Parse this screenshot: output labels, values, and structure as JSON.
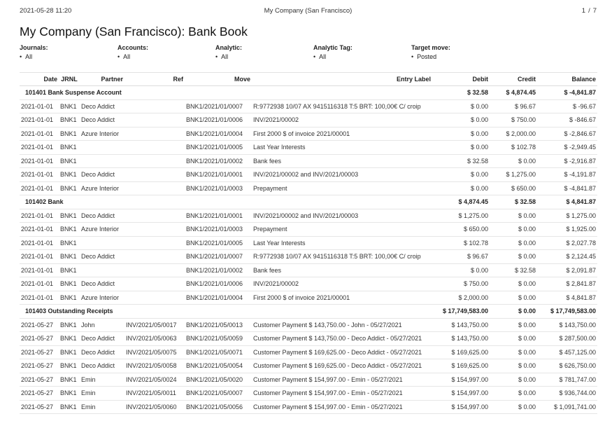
{
  "print_header": {
    "timestamp": "2021-05-28 11:20",
    "company": "My Company (San Francisco)",
    "page_current": "1",
    "page_sep": "/",
    "page_total": "7"
  },
  "title": "My Company (San Francisco): Bank Book",
  "filters": [
    {
      "label": "Journals:",
      "value": "All"
    },
    {
      "label": "Accounts:",
      "value": "All"
    },
    {
      "label": "Analytic:",
      "value": "All"
    },
    {
      "label": "Analytic Tag:",
      "value": "All"
    },
    {
      "label": "Target move:",
      "value": "Posted"
    }
  ],
  "columns": {
    "date": "Date",
    "jrnl": "JRNL",
    "partner": "Partner",
    "ref": "Ref",
    "move": "Move",
    "entry_label": "Entry Label",
    "debit": "Debit",
    "credit": "Credit",
    "balance": "Balance"
  },
  "accounts": [
    {
      "name": "101401 Bank Suspense Account",
      "debit": "$ 32.58",
      "credit": "$ 4,874.45",
      "balance": "$ -4,841.87",
      "lines": [
        {
          "date": "2021-01-01",
          "jrnl": "BNK1",
          "partner": "Deco Addict",
          "ref": "",
          "move": "BNK1/2021/01/0007",
          "label": "R:9772938 10/07 AX 9415116318 T:5 BRT: 100,00€ C/ croip",
          "debit": "$ 0.00",
          "credit": "$ 96.67",
          "balance": "$ -96.67"
        },
        {
          "date": "2021-01-01",
          "jrnl": "BNK1",
          "partner": "Deco Addict",
          "ref": "",
          "move": "BNK1/2021/01/0006",
          "label": "INV/2021/00002",
          "debit": "$ 0.00",
          "credit": "$ 750.00",
          "balance": "$ -846.67"
        },
        {
          "date": "2021-01-01",
          "jrnl": "BNK1",
          "partner": "Azure Interior",
          "ref": "",
          "move": "BNK1/2021/01/0004",
          "label": "First 2000 $ of invoice 2021/00001",
          "debit": "$ 0.00",
          "credit": "$ 2,000.00",
          "balance": "$ -2,846.67"
        },
        {
          "date": "2021-01-01",
          "jrnl": "BNK1",
          "partner": "",
          "ref": "",
          "move": "BNK1/2021/01/0005",
          "label": "Last Year Interests",
          "debit": "$ 0.00",
          "credit": "$ 102.78",
          "balance": "$ -2,949.45"
        },
        {
          "date": "2021-01-01",
          "jrnl": "BNK1",
          "partner": "",
          "ref": "",
          "move": "BNK1/2021/01/0002",
          "label": "Bank fees",
          "debit": "$ 32.58",
          "credit": "$ 0.00",
          "balance": "$ -2,916.87"
        },
        {
          "date": "2021-01-01",
          "jrnl": "BNK1",
          "partner": "Deco Addict",
          "ref": "",
          "move": "BNK1/2021/01/0001",
          "label": "INV/2021/00002 and INV/2021/00003",
          "debit": "$ 0.00",
          "credit": "$ 1,275.00",
          "balance": "$ -4,191.87"
        },
        {
          "date": "2021-01-01",
          "jrnl": "BNK1",
          "partner": "Azure Interior",
          "ref": "",
          "move": "BNK1/2021/01/0003",
          "label": "Prepayment",
          "debit": "$ 0.00",
          "credit": "$ 650.00",
          "balance": "$ -4,841.87"
        }
      ]
    },
    {
      "name": "101402 Bank",
      "debit": "$ 4,874.45",
      "credit": "$ 32.58",
      "balance": "$ 4,841.87",
      "lines": [
        {
          "date": "2021-01-01",
          "jrnl": "BNK1",
          "partner": "Deco Addict",
          "ref": "",
          "move": "BNK1/2021/01/0001",
          "label": "INV/2021/00002 and INV/2021/00003",
          "debit": "$ 1,275.00",
          "credit": "$ 0.00",
          "balance": "$ 1,275.00"
        },
        {
          "date": "2021-01-01",
          "jrnl": "BNK1",
          "partner": "Azure Interior",
          "ref": "",
          "move": "BNK1/2021/01/0003",
          "label": "Prepayment",
          "debit": "$ 650.00",
          "credit": "$ 0.00",
          "balance": "$ 1,925.00"
        },
        {
          "date": "2021-01-01",
          "jrnl": "BNK1",
          "partner": "",
          "ref": "",
          "move": "BNK1/2021/01/0005",
          "label": "Last Year Interests",
          "debit": "$ 102.78",
          "credit": "$ 0.00",
          "balance": "$ 2,027.78"
        },
        {
          "date": "2021-01-01",
          "jrnl": "BNK1",
          "partner": "Deco Addict",
          "ref": "",
          "move": "BNK1/2021/01/0007",
          "label": "R:9772938 10/07 AX 9415116318 T:5 BRT: 100,00€ C/ croip",
          "debit": "$ 96.67",
          "credit": "$ 0.00",
          "balance": "$ 2,124.45"
        },
        {
          "date": "2021-01-01",
          "jrnl": "BNK1",
          "partner": "",
          "ref": "",
          "move": "BNK1/2021/01/0002",
          "label": "Bank fees",
          "debit": "$ 0.00",
          "credit": "$ 32.58",
          "balance": "$ 2,091.87"
        },
        {
          "date": "2021-01-01",
          "jrnl": "BNK1",
          "partner": "Deco Addict",
          "ref": "",
          "move": "BNK1/2021/01/0006",
          "label": "INV/2021/00002",
          "debit": "$ 750.00",
          "credit": "$ 0.00",
          "balance": "$ 2,841.87"
        },
        {
          "date": "2021-01-01",
          "jrnl": "BNK1",
          "partner": "Azure Interior",
          "ref": "",
          "move": "BNK1/2021/01/0004",
          "label": "First 2000 $ of invoice 2021/00001",
          "debit": "$ 2,000.00",
          "credit": "$ 0.00",
          "balance": "$ 4,841.87"
        }
      ]
    },
    {
      "name": "101403 Outstanding Receipts",
      "debit": "$ 17,749,583.00",
      "credit": "$ 0.00",
      "balance": "$ 17,749,583.00",
      "lines": [
        {
          "date": "2021-05-27",
          "jrnl": "BNK1",
          "partner": "John",
          "ref": "INV/2021/05/0017",
          "move": "BNK1/2021/05/0013",
          "label": "Customer Payment $ 143,750.00 - John - 05/27/2021",
          "debit": "$ 143,750.00",
          "credit": "$ 0.00",
          "balance": "$ 143,750.00"
        },
        {
          "date": "2021-05-27",
          "jrnl": "BNK1",
          "partner": "Deco Addict",
          "ref": "INV/2021/05/0063",
          "move": "BNK1/2021/05/0059",
          "label": "Customer Payment $ 143,750.00 - Deco Addict - 05/27/2021",
          "debit": "$ 143,750.00",
          "credit": "$ 0.00",
          "balance": "$ 287,500.00"
        },
        {
          "date": "2021-05-27",
          "jrnl": "BNK1",
          "partner": "Deco Addict",
          "ref": "INV/2021/05/0075",
          "move": "BNK1/2021/05/0071",
          "label": "Customer Payment $ 169,625.00 - Deco Addict - 05/27/2021",
          "debit": "$ 169,625.00",
          "credit": "$ 0.00",
          "balance": "$ 457,125.00"
        },
        {
          "date": "2021-05-27",
          "jrnl": "BNK1",
          "partner": "Deco Addict",
          "ref": "INV/2021/05/0058",
          "move": "BNK1/2021/05/0054",
          "label": "Customer Payment $ 169,625.00 - Deco Addict - 05/27/2021",
          "debit": "$ 169,625.00",
          "credit": "$ 0.00",
          "balance": "$ 626,750.00"
        },
        {
          "date": "2021-05-27",
          "jrnl": "BNK1",
          "partner": "Emin",
          "ref": "INV/2021/05/0024",
          "move": "BNK1/2021/05/0020",
          "label": "Customer Payment $ 154,997.00 - Emin - 05/27/2021",
          "debit": "$ 154,997.00",
          "credit": "$ 0.00",
          "balance": "$ 781,747.00"
        },
        {
          "date": "2021-05-27",
          "jrnl": "BNK1",
          "partner": "Emin",
          "ref": "INV/2021/05/0011",
          "move": "BNK1/2021/05/0007",
          "label": "Customer Payment $ 154,997.00 - Emin - 05/27/2021",
          "debit": "$ 154,997.00",
          "credit": "$ 0.00",
          "balance": "$ 936,744.00"
        },
        {
          "date": "2021-05-27",
          "jrnl": "BNK1",
          "partner": "Emin",
          "ref": "INV/2021/05/0060",
          "move": "BNK1/2021/05/0056",
          "label": "Customer Payment $ 154,997.00 - Emin - 05/27/2021",
          "debit": "$ 154,997.00",
          "credit": "$ 0.00",
          "balance": "$ 1,091,741.00"
        }
      ]
    }
  ]
}
